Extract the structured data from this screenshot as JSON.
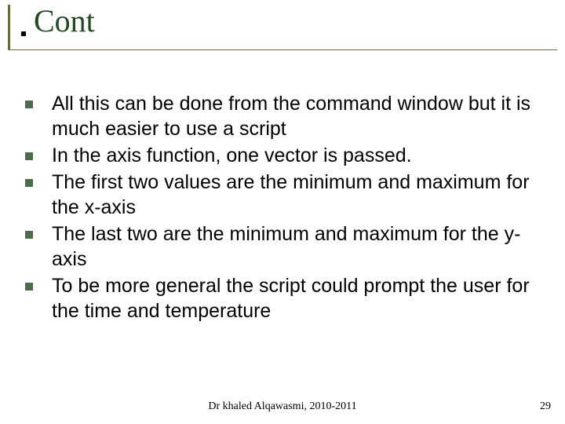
{
  "title": "Cont",
  "bullets": [
    "All this can be done from the command window but  it is much easier to use a script",
    "In the axis function, one vector is passed.",
    "The first two values are the minimum and maximum for the x-axis",
    "The last two are the minimum and maximum for the y-axis",
    "To be more general the script could prompt the user for the time and temperature"
  ],
  "footer": {
    "center": "Dr khaled Alqawasmi, 2010-2011",
    "page": "29"
  }
}
